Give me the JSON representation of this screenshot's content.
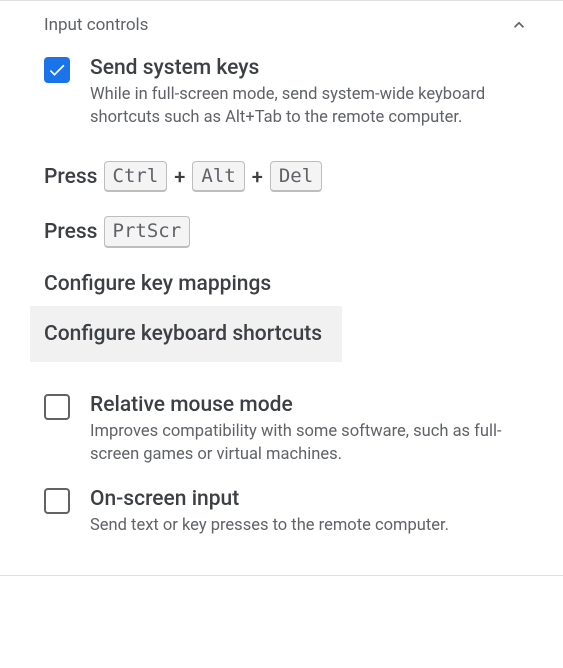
{
  "panel": {
    "title": "Input controls"
  },
  "sendSystemKeys": {
    "checked": true,
    "title": "Send system keys",
    "description": "While in full-screen mode, send system-wide keyboard shortcuts such as Alt+Tab to the remote computer."
  },
  "pressCtrlAltDel": {
    "prefix": "Press",
    "keys": [
      "Ctrl",
      "Alt",
      "Del"
    ]
  },
  "pressPrtScr": {
    "prefix": "Press",
    "keys": [
      "PrtScr"
    ]
  },
  "configureKeyMappings": {
    "label": "Configure key mappings"
  },
  "configureKeyboardShortcuts": {
    "label": "Configure keyboard shortcuts"
  },
  "relativeMouse": {
    "checked": false,
    "title": "Relative mouse mode",
    "description": "Improves compatibility with some software, such as full-screen games or virtual machines."
  },
  "onScreenInput": {
    "checked": false,
    "title": "On-screen input",
    "description": "Send text or key presses to the remote computer."
  }
}
